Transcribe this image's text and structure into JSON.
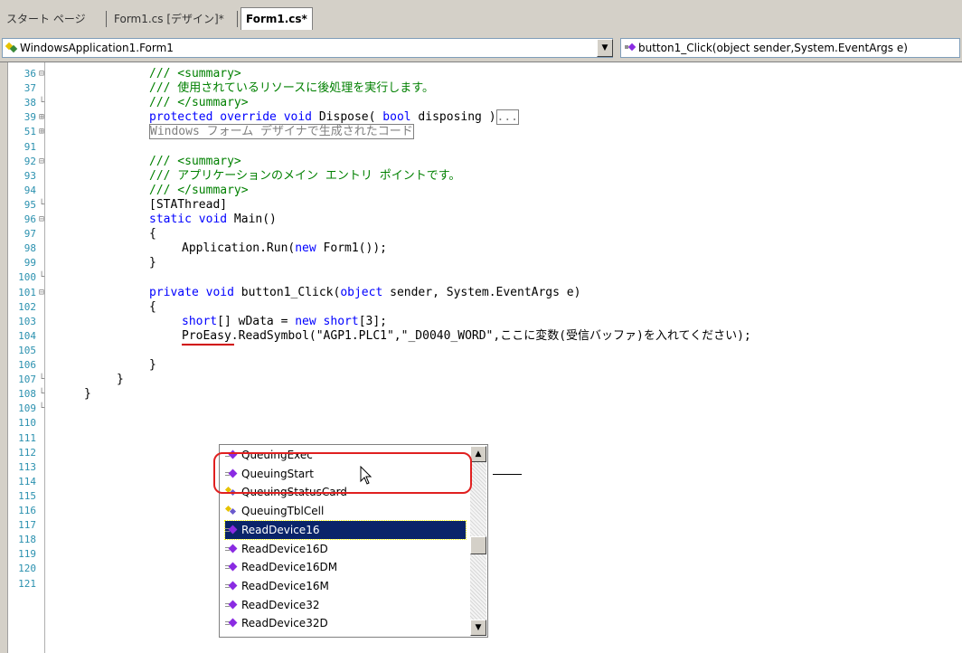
{
  "tabs": [
    {
      "label": "スタート ページ",
      "active": false
    },
    {
      "label": "Form1.cs [デザイン]*",
      "active": false
    },
    {
      "label": "Form1.cs*",
      "active": true
    }
  ],
  "dropdowns": {
    "class_selector": "WindowsApplication1.Form1",
    "member_selector": "button1_Click(object sender,System.EventArgs e)"
  },
  "code_lines": [
    {
      "num": "36",
      "outline": "⊟",
      "text": "/// <summary>"
    },
    {
      "num": "37",
      "outline": "",
      "text": "/// 使用されているリソースに後処理を実行します。"
    },
    {
      "num": "38",
      "outline": "└",
      "text": "/// </summary>"
    },
    {
      "num": "39",
      "outline": "⊞",
      "text_kw1": "protected override void",
      "text_mid": " Dispose( ",
      "text_kw2": "bool",
      "text_end": " disposing )",
      "ellipsis": "..."
    },
    {
      "num": "51",
      "outline": "⊞",
      "region": "Windows フォーム デザイナで生成されたコード"
    },
    {
      "num": "91",
      "outline": "",
      "text": ""
    },
    {
      "num": "92",
      "outline": "⊟",
      "text": "/// <summary>"
    },
    {
      "num": "93",
      "outline": "",
      "text": "/// アプリケーションのメイン エントリ ポイントです。"
    },
    {
      "num": "94",
      "outline": "",
      "text": "/// </summary>"
    },
    {
      "num": "95",
      "outline": "└",
      "text": "[STAThread]"
    },
    {
      "num": "96",
      "outline": "⊟",
      "kw": "static void",
      "text": " Main()"
    },
    {
      "num": "97",
      "outline": "",
      "text": "{"
    },
    {
      "num": "98",
      "outline": "",
      "pre": "Application.Run(",
      "kw": "new",
      "text": " Form1());"
    },
    {
      "num": "99",
      "outline": "",
      "text": "}"
    },
    {
      "num": "100",
      "outline": "└",
      "text": ""
    },
    {
      "num": "101",
      "outline": "⊟",
      "kw": "private void",
      "mid": " button1_Click(",
      "kw2": "object",
      "text": " sender, System.EventArgs e)"
    },
    {
      "num": "102",
      "outline": "",
      "text": "{"
    },
    {
      "num": "103",
      "outline": "",
      "kw": "short",
      "mid": "[] wData = ",
      "kw2": "new short",
      "text": "[3];"
    },
    {
      "num": "104",
      "outline": "",
      "pre": "ProEasy.",
      "text": "ReadSymbol(\"AGP1.PLC1\",\"_D0040_WORD\",ここに変数(受信バッファ)を入れてください);"
    },
    {
      "num": "105",
      "outline": "",
      "text": ""
    },
    {
      "num": "106",
      "outline": "",
      "text": "}"
    },
    {
      "num": "107",
      "outline": "└",
      "text": "}"
    },
    {
      "num": "108",
      "outline": "└",
      "text": "}"
    },
    {
      "num": "109",
      "outline": "└",
      "text": ""
    },
    {
      "num": "110",
      "outline": "",
      "text": ""
    },
    {
      "num": "111",
      "outline": "",
      "text": ""
    },
    {
      "num": "112",
      "outline": "",
      "text": ""
    },
    {
      "num": "113",
      "outline": "",
      "text": ""
    },
    {
      "num": "114",
      "outline": "",
      "text": ""
    },
    {
      "num": "115",
      "outline": "",
      "text": ""
    },
    {
      "num": "116",
      "outline": "",
      "text": ""
    },
    {
      "num": "117",
      "outline": "",
      "text": ""
    },
    {
      "num": "118",
      "outline": "",
      "text": ""
    },
    {
      "num": "119",
      "outline": "",
      "text": ""
    },
    {
      "num": "120",
      "outline": "",
      "text": ""
    },
    {
      "num": "121",
      "outline": "",
      "text": ""
    }
  ],
  "intellisense": {
    "items": [
      {
        "label": "QueuingExec",
        "icon": "method-icon",
        "selected": false
      },
      {
        "label": "QueuingStart",
        "icon": "method-icon",
        "selected": false
      },
      {
        "label": "QueuingStatusCard",
        "icon": "property-icon",
        "selected": false
      },
      {
        "label": "QueuingTblCell",
        "icon": "property-icon",
        "selected": false
      },
      {
        "label": "ReadDevice16",
        "icon": "method-icon",
        "selected": true
      },
      {
        "label": "ReadDevice16D",
        "icon": "method-icon",
        "selected": false
      },
      {
        "label": "ReadDevice16DM",
        "icon": "method-icon",
        "selected": false
      },
      {
        "label": "ReadDevice16M",
        "icon": "method-icon",
        "selected": false
      },
      {
        "label": "ReadDevice32",
        "icon": "method-icon",
        "selected": false
      },
      {
        "label": "ReadDevice32D",
        "icon": "method-icon",
        "selected": false
      }
    ]
  },
  "colors": {
    "keyword": "#0000ff",
    "comment": "#008000",
    "line_number": "#2b91af",
    "selection": "#0a246a",
    "highlight": "#e02020"
  }
}
